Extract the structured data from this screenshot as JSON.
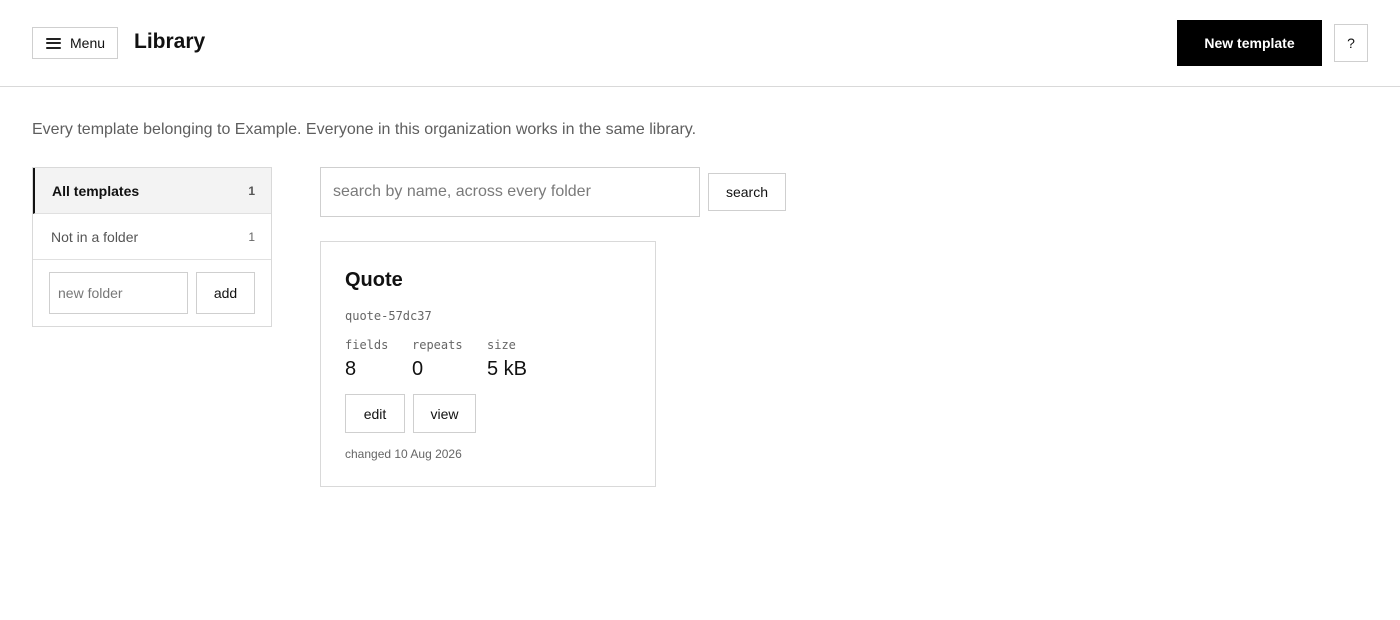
{
  "header": {
    "menu_label": "Menu",
    "title": "Library",
    "new_template_label": "New template",
    "help_label": "?"
  },
  "intro_text": "Every template belonging to Example. Everyone in this organization works in the same library.",
  "sidebar": {
    "items": [
      {
        "label": "All templates",
        "count": "1",
        "active": true
      },
      {
        "label": "Not in a folder",
        "count": "1",
        "active": false
      }
    ],
    "new_folder_placeholder": "new folder",
    "add_label": "add"
  },
  "search": {
    "placeholder": "search by name, across every folder",
    "button_label": "search"
  },
  "templates": [
    {
      "name": "Quote",
      "slug": "quote-57dc37",
      "stats": [
        {
          "label": "fields",
          "value": "8"
        },
        {
          "label": "repeats",
          "value": "0"
        },
        {
          "label": "size",
          "value": "5 kB"
        }
      ],
      "edit_label": "edit",
      "view_label": "view",
      "changed": "changed 10 Aug 2026"
    }
  ]
}
